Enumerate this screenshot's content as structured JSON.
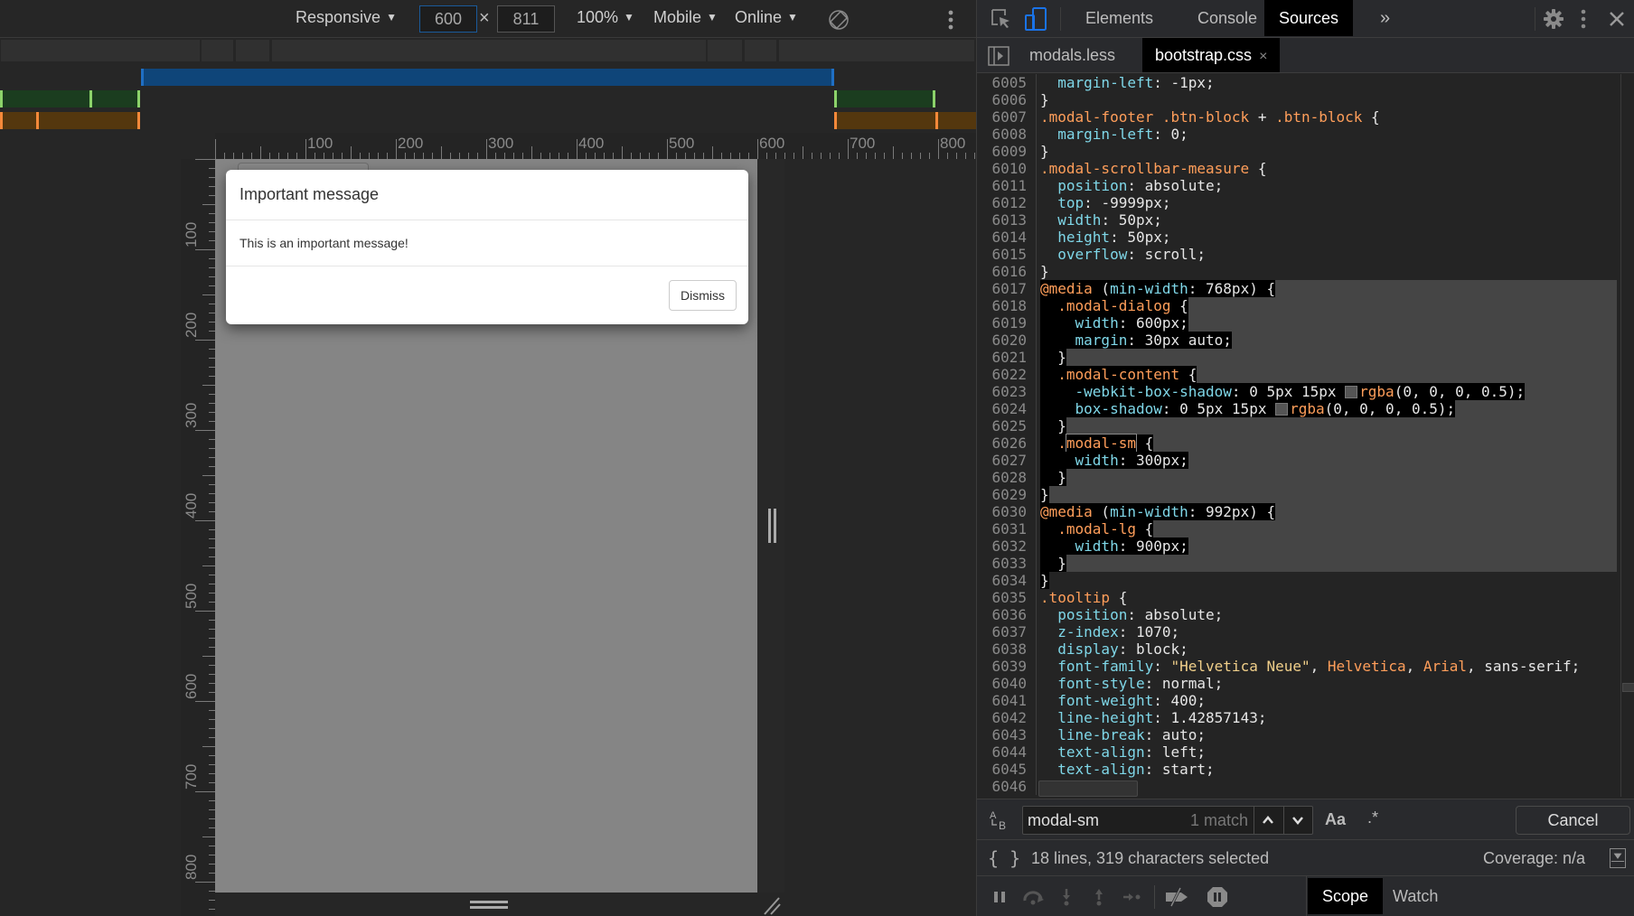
{
  "device_toolbar": {
    "device_label": "Responsive",
    "width_value": "600",
    "height_value": "811",
    "times_symbol": "×",
    "zoom_label": "100%",
    "device_type_label": "Mobile",
    "throttle_label": "Online",
    "caret": "▼",
    "rotate_icon": "rotate-icon",
    "more_icon": "more-vertical-icon"
  },
  "ruler": {
    "top_labels": [
      "100",
      "200",
      "300",
      "400",
      "500",
      "600",
      "700",
      "800"
    ],
    "left_labels": [
      "100",
      "200",
      "300",
      "400",
      "500",
      "600",
      "700",
      "800"
    ]
  },
  "page": {
    "modal": {
      "title": "Important message",
      "body": "This is an important message!",
      "dismiss_label": "Dismiss"
    }
  },
  "devtools": {
    "tabs": [
      {
        "label": "Elements",
        "active": false
      },
      {
        "label": "Console",
        "active": false
      },
      {
        "label": "Sources",
        "active": true
      }
    ],
    "more_tabs_label": "»",
    "files": [
      {
        "label": "modals.less",
        "active": false
      },
      {
        "label": "bootstrap.css",
        "active": true
      }
    ],
    "close_tab_symbol": "×",
    "code_lines": [
      {
        "n": "6005",
        "html": "  <span class=\"prop\">margin-left</span>: -1px;",
        "sel": false
      },
      {
        "n": "6006",
        "html": "}",
        "sel": false
      },
      {
        "n": "6007",
        "html": "<span class=\"sel-sel\">.modal-footer .btn-block</span> + <span class=\"sel-sel\">.btn-block</span> {",
        "sel": false
      },
      {
        "n": "6008",
        "html": "  <span class=\"prop\">margin-left</span>: 0;",
        "sel": false
      },
      {
        "n": "6009",
        "html": "}",
        "sel": false
      },
      {
        "n": "6010",
        "html": "<span class=\"sel-sel\">.modal-scrollbar-measure</span> {",
        "sel": false
      },
      {
        "n": "6011",
        "html": "  <span class=\"prop\">position</span>: absolute;",
        "sel": false
      },
      {
        "n": "6012",
        "html": "  <span class=\"prop\">top</span>: -9999px;",
        "sel": false
      },
      {
        "n": "6013",
        "html": "  <span class=\"prop\">width</span>: 50px;",
        "sel": false
      },
      {
        "n": "6014",
        "html": "  <span class=\"prop\">height</span>: 50px;",
        "sel": false
      },
      {
        "n": "6015",
        "html": "  <span class=\"prop\">overflow</span>: scroll;",
        "sel": false
      },
      {
        "n": "6016",
        "html": "}",
        "sel": false
      },
      {
        "n": "6017",
        "html": "<span class=\"sel\"><span class=\"at\">@media</span> (<span class=\"prop\">min-width</span>: 768px) {</span>",
        "sel": true
      },
      {
        "n": "6018",
        "html": "<span class=\"sel\">  <span class=\"sel-sel\">.modal-dialog</span> {</span>",
        "sel": true
      },
      {
        "n": "6019",
        "html": "<span class=\"sel\">    <span class=\"prop\">width</span>: 600px;</span>",
        "sel": true
      },
      {
        "n": "6020",
        "html": "<span class=\"sel\">    <span class=\"prop\">margin</span>: 30px auto;</span>",
        "sel": true
      },
      {
        "n": "6021",
        "html": "<span class=\"sel\">  }</span>",
        "sel": true
      },
      {
        "n": "6022",
        "html": "<span class=\"sel\">  <span class=\"sel-sel\">.modal-content</span> {</span>",
        "sel": true
      },
      {
        "n": "6023",
        "html": "<span class=\"sel\">    <span class=\"prop\">-webkit-box-shadow</span>: 0 5px 15px <span class=\"swatch\"></span><span class=\"fn\">rgba</span>(0, 0, 0, 0.5);</span>",
        "sel": true
      },
      {
        "n": "6024",
        "html": "<span class=\"sel\">    <span class=\"prop\">box-shadow</span>: 0 5px 15px <span class=\"swatch\"></span><span class=\"fn\">rgba</span>(0, 0, 0, 0.5);</span>",
        "sel": true
      },
      {
        "n": "6025",
        "html": "<span class=\"sel\">  }</span>",
        "sel": true
      },
      {
        "n": "6026",
        "html": "<span class=\"sel\">  <span class=\"sel-sel\">.<span class=\"match\">modal-sm</span></span> {</span>",
        "sel": true
      },
      {
        "n": "6027",
        "html": "<span class=\"sel\">    <span class=\"prop\">width</span>: 300px;</span>",
        "sel": true
      },
      {
        "n": "6028",
        "html": "<span class=\"sel\">  }</span>",
        "sel": true
      },
      {
        "n": "6029",
        "html": "<span class=\"sel\">}</span>",
        "sel": true
      },
      {
        "n": "6030",
        "html": "<span class=\"sel\"><span class=\"at\">@media</span> (<span class=\"prop\">min-width</span>: 992px) {</span>",
        "sel": true
      },
      {
        "n": "6031",
        "html": "<span class=\"sel\">  <span class=\"sel-sel\">.modal-lg</span> {</span>",
        "sel": true
      },
      {
        "n": "6032",
        "html": "<span class=\"sel\">    <span class=\"prop\">width</span>: 900px;</span>",
        "sel": true
      },
      {
        "n": "6033",
        "html": "<span class=\"sel\">  }</span>",
        "sel": true
      },
      {
        "n": "6034",
        "html": "<span class=\"sel\">}</span>",
        "sel": false
      },
      {
        "n": "6035",
        "html": "<span class=\"sel-sel\">.tooltip</span> {",
        "sel": false
      },
      {
        "n": "6036",
        "html": "  <span class=\"prop\">position</span>: absolute;",
        "sel": false
      },
      {
        "n": "6037",
        "html": "  <span class=\"prop\">z-index</span>: 1070;",
        "sel": false
      },
      {
        "n": "6038",
        "html": "  <span class=\"prop\">display</span>: block;",
        "sel": false
      },
      {
        "n": "6039",
        "html": "  <span class=\"prop\">font-family</span>: <span class=\"str\">\"Helvetica Neue\"</span>, <span class=\"fn\">Helvetica</span>, <span class=\"fn\">Arial</span>, sans-serif;",
        "sel": false
      },
      {
        "n": "6040",
        "html": "  <span class=\"prop\">font-style</span>: normal;",
        "sel": false
      },
      {
        "n": "6041",
        "html": "  <span class=\"prop\">font-weight</span>: 400;",
        "sel": false
      },
      {
        "n": "6042",
        "html": "  <span class=\"prop\">line-height</span>: 1.42857143;",
        "sel": false
      },
      {
        "n": "6043",
        "html": "  <span class=\"prop\">line-break</span>: auto;",
        "sel": false
      },
      {
        "n": "6044",
        "html": "  <span class=\"prop\">text-align</span>: left;",
        "sel": false
      },
      {
        "n": "6045",
        "html": "  <span class=\"prop\">text-align</span>: start;",
        "sel": false
      },
      {
        "n": "6046",
        "html": "",
        "sel": false
      }
    ],
    "search": {
      "query": "modal-sm",
      "match_count": "1 match",
      "prev_symbol": "⌃",
      "next_symbol": "⌄",
      "case_label": "Aa",
      "regex_label": ".*",
      "cancel_label": "Cancel",
      "replace_toggle_label": "A↳B"
    },
    "status": {
      "pretty_print_label": "{ }",
      "selection_info": "18 lines, 319 characters selected",
      "coverage": "Coverage: n/a"
    },
    "debugger": {
      "scope_label": "Scope",
      "watch_label": "Watch"
    }
  },
  "colors": {
    "accent_blue": "#1a73e8",
    "media_bar_blue": "#0f4579",
    "media_bar_green": "#1b3d1f",
    "media_bar_orange": "#54370e"
  }
}
